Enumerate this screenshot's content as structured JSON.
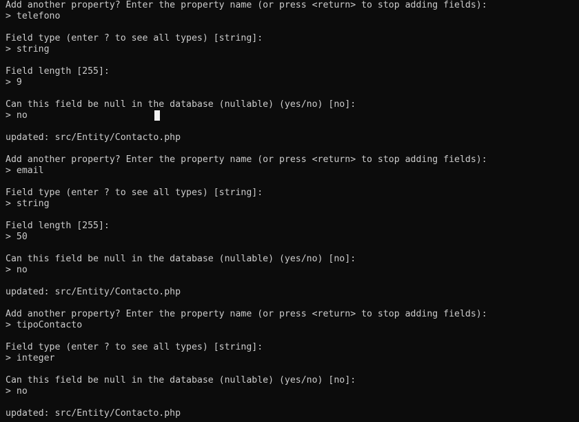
{
  "terminal": {
    "lines": [
      "Add another property? Enter the property name (or press <return> to stop adding fields):",
      "> telefono",
      "",
      "Field type (enter ? to see all types) [string]:",
      "> string",
      "",
      "Field length [255]:",
      "> 9",
      "",
      "Can this field be null in the database (nullable) (yes/no) [no]:",
      "> no",
      "",
      "updated: src/Entity/Contacto.php",
      "",
      "Add another property? Enter the property name (or press <return> to stop adding fields):",
      "> email",
      "",
      "Field type (enter ? to see all types) [string]:",
      "> string",
      "",
      "Field length [255]:",
      "> 50",
      "",
      "Can this field be null in the database (nullable) (yes/no) [no]:",
      "> no",
      "",
      "updated: src/Entity/Contacto.php",
      "",
      "Add another property? Enter the property name (or press <return> to stop adding fields):",
      "> tipoContacto",
      "",
      "Field type (enter ? to see all types) [string]:",
      "> integer",
      "",
      "Can this field be null in the database (nullable) (yes/no) [no]:",
      "> no",
      "",
      "updated: src/Entity/Contacto.php"
    ]
  }
}
